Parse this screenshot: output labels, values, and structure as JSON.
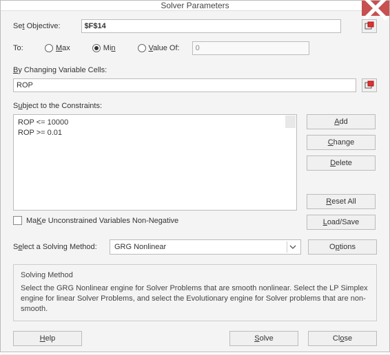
{
  "title": "Solver Parameters",
  "labels": {
    "set_objective_pre": "Se",
    "set_objective_u": "t",
    "set_objective_post": " Objective:",
    "to": "To:",
    "max_u": "M",
    "max_post": "ax",
    "min_pre": "Mi",
    "min_u": "n",
    "valueof_u": "V",
    "valueof_post": "alue Of:",
    "changing_u": "B",
    "changing_post": "y Changing Variable Cells:",
    "subject_pre": "S",
    "subject_u": "u",
    "subject_post": "bject to the Constraints:",
    "make_u": "K",
    "make_pre": "Ma",
    "make_post": "e Unconstrained Variables Non-Negative",
    "select_pre": "S",
    "select_u": "e",
    "select_post": "lect a Solving Method:",
    "info_title": "Solving Method",
    "info_body": "Select the GRG Nonlinear engine for Solver Problems that are smooth nonlinear. Select the LP Simplex engine for linear Solver Problems, and select the Evolutionary engine for Solver problems that are non-smooth."
  },
  "objective": "$F$14",
  "valueof": "0",
  "changing_cells": "ROP",
  "constraints": [
    "ROP <= 10000",
    "ROP >= 0.01"
  ],
  "solving_method": "GRG Nonlinear",
  "buttons": {
    "add_u": "A",
    "add_post": "dd",
    "change_u": "C",
    "change_post": "hange",
    "delete_u": "D",
    "delete_post": "elete",
    "reset_u": "R",
    "reset_post": "eset All",
    "load_u": "L",
    "load_post": "oad/Save",
    "options_pre": "O",
    "options_u": "p",
    "options_post": "tions",
    "help_u": "H",
    "help_post": "elp",
    "solve_u": "S",
    "solve_post": "olve",
    "close_pre": "Cl",
    "close_u": "o",
    "close_post": "se"
  }
}
